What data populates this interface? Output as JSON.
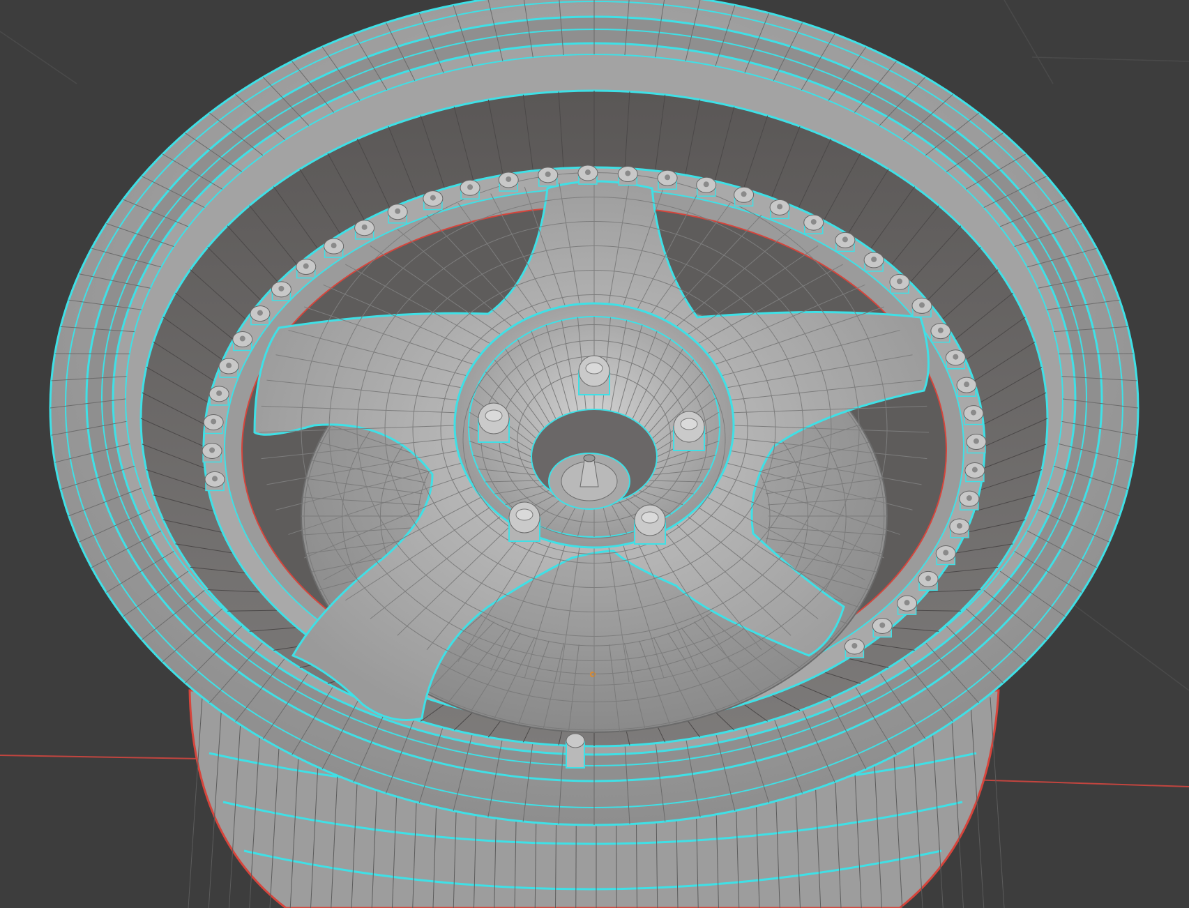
{
  "viewport": {
    "background": "#3d3d3d",
    "grid_color": "#4a4a4a",
    "x_axis_color": "#c2453f",
    "mesh_color": "#9c9c9c",
    "mesh_light": "#bdbdbd",
    "mesh_dark": "#6f6f6f",
    "wire_color": "#2b2b2b",
    "seam_color": "#3fe0e6",
    "boundary_color": "#d6453c",
    "origin_color": "#e08a2a"
  },
  "scene": {
    "object": "wheel-rim",
    "spoke_count": 5,
    "lug_nut_count": 5,
    "rim_bolt_count": 40
  }
}
